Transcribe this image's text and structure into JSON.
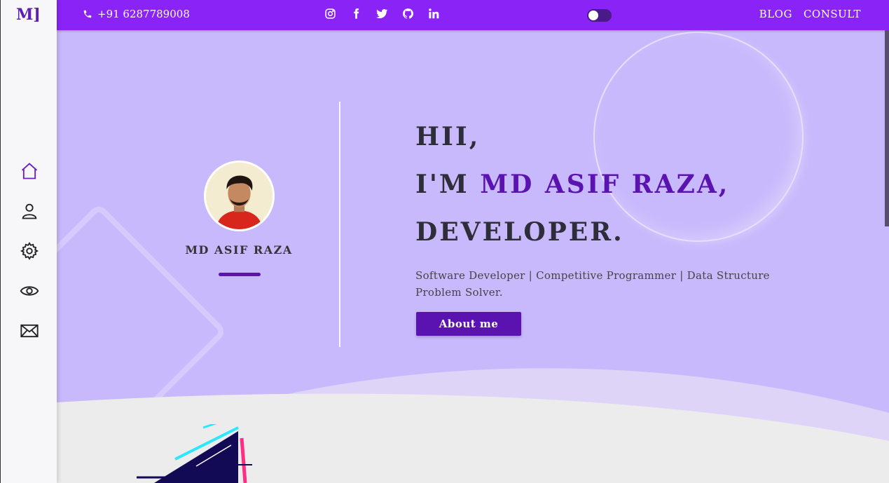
{
  "brand": {
    "logo_text": "M]"
  },
  "topbar": {
    "phone": "+91 6287789008",
    "socials": [
      "instagram-icon",
      "facebook-icon",
      "twitter-icon",
      "github-icon",
      "linkedin-icon"
    ],
    "links": {
      "blog": "BLOG",
      "consult": "CONSULT"
    }
  },
  "sidebar": {
    "items": [
      "home-icon",
      "user-icon",
      "gear-icon",
      "eye-icon",
      "mail-icon"
    ]
  },
  "profile": {
    "name": "MD ASIF RAZA"
  },
  "hero": {
    "line1": "HII,",
    "line2_prefix": "I'M ",
    "line2_name": "MD ASIF RAZA,",
    "line3": "DEVELOPER.",
    "tagline": "Software Developer | Competitive Programmer | Data Structure Problem Solver.",
    "button_label": "About me"
  },
  "colors": {
    "primary": "#8a23f6",
    "accent": "#5a12b0",
    "hero_bg": "#c8b9fc"
  }
}
